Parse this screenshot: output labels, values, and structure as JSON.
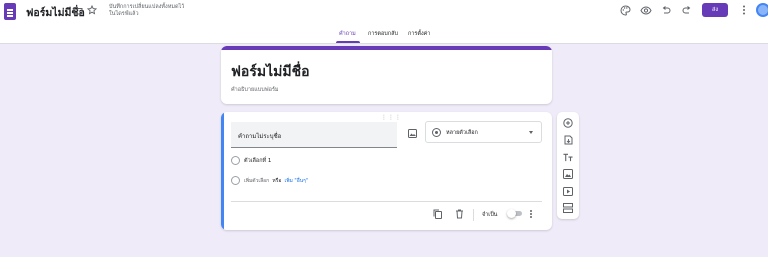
{
  "header": {
    "form_name": "ฟอร์มไม่มีชื่อ",
    "save_status": "บันทึกการเปลี่ยนแปลงทั้งหมดไว้ในไดรฟ์แล้ว",
    "send_label": "ส่ง",
    "icons": [
      "forms-app-icon",
      "folder-icon",
      "star-icon",
      "palette-icon",
      "eye-icon",
      "undo-icon",
      "redo-icon",
      "more-vert-icon",
      "account-avatar"
    ]
  },
  "tabs": [
    {
      "label": "คำถาม",
      "active": true
    },
    {
      "label": "การตอบกลับ",
      "active": false
    },
    {
      "label": "การตั้งค่า",
      "active": false
    }
  ],
  "title_card": {
    "title": "ฟอร์มไม่มีชื่อ",
    "description": "คำอธิบายแบบฟอร์ม"
  },
  "question": {
    "title": "คำถามไม่ระบุชื่อ",
    "type_label": "หลายตัวเลือก",
    "options": [
      "ตัวเลือกที่ 1"
    ],
    "add_option": "เพิ่มตัวเลือก",
    "or_word": "หรือ",
    "add_other": "เพิ่ม \"อื่นๆ\"",
    "required_label": "จำเป็น",
    "required": false
  },
  "side_toolbar": [
    "add-question-icon",
    "import-questions-icon",
    "add-title-icon",
    "add-image-icon",
    "add-video-icon",
    "add-section-icon"
  ],
  "colors": {
    "accent": "#673ab7",
    "background": "#f0ebf8",
    "active_question_bar": "#4285f4",
    "link": "#1a73e8"
  }
}
